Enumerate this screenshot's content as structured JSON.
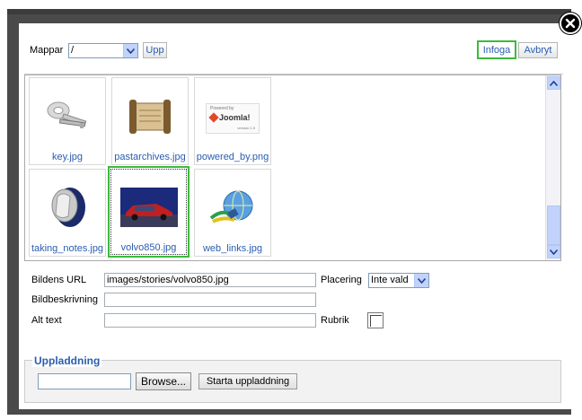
{
  "close_icon": "close-icon",
  "toolbar": {
    "folder_label": "Mappar",
    "folder_value": "/",
    "up_label": "Upp",
    "insert_label": "Infoga",
    "cancel_label": "Avbryt"
  },
  "images": [
    {
      "caption": "key.jpg",
      "icon": "keys-icon"
    },
    {
      "caption": "pastarchives.jpg",
      "icon": "scroll-icon"
    },
    {
      "caption": "powered_by.png",
      "icon": "joomla-logo-icon"
    },
    {
      "caption": "taking_notes.jpg",
      "icon": "notes-icon"
    },
    {
      "caption": "volvo850.jpg",
      "icon": "car-photo-icon",
      "selected": true
    },
    {
      "caption": "web_links.jpg",
      "icon": "web-links-icon"
    }
  ],
  "joomla_badge": {
    "powered": "Powered by",
    "brand": "Joomla!",
    "version": "version 1.5"
  },
  "fields": {
    "url_label": "Bildens URL",
    "url_value": "images/stories/volvo850.jpg",
    "description_label": "Bildbeskrivning",
    "description_value": "",
    "alt_label": "Alt text",
    "alt_value": "",
    "placement_label": "Placering",
    "placement_value": "Inte vald",
    "caption_label": "Rubrik"
  },
  "upload": {
    "legend": "Uppladdning",
    "browse_label": "Browse...",
    "start_label": "Starta uppladdning"
  },
  "colors": {
    "accent_blue": "#2a5db0",
    "selection_green": "#3cba3c",
    "overlay_dark": "#4a4a4a"
  }
}
